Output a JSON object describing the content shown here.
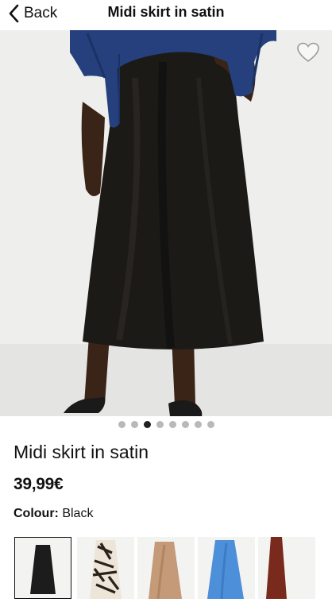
{
  "header": {
    "back_label": "Back",
    "title": "Midi skirt in satin"
  },
  "gallery": {
    "image_count": 8,
    "active_index": 2,
    "favorite_icon": "heart-outline-icon"
  },
  "product": {
    "name": "Midi skirt in satin",
    "price": "39,99€",
    "colour_label": "Colour:",
    "colour_value": "Black"
  },
  "colour_options": [
    {
      "name": "black",
      "color": "#1c1c1c",
      "selected": true
    },
    {
      "name": "zebra-print",
      "color": "#e9e2d6",
      "selected": false
    },
    {
      "name": "camel",
      "color": "#c49a78",
      "selected": false
    },
    {
      "name": "sky-blue",
      "color": "#4d8fd9",
      "selected": false
    },
    {
      "name": "rust-brown",
      "color": "#7a2a1c",
      "selected": false
    }
  ],
  "colors": {
    "accent": "#111111",
    "dot_inactive": "#b9b9b9",
    "dot_active": "#222222"
  }
}
